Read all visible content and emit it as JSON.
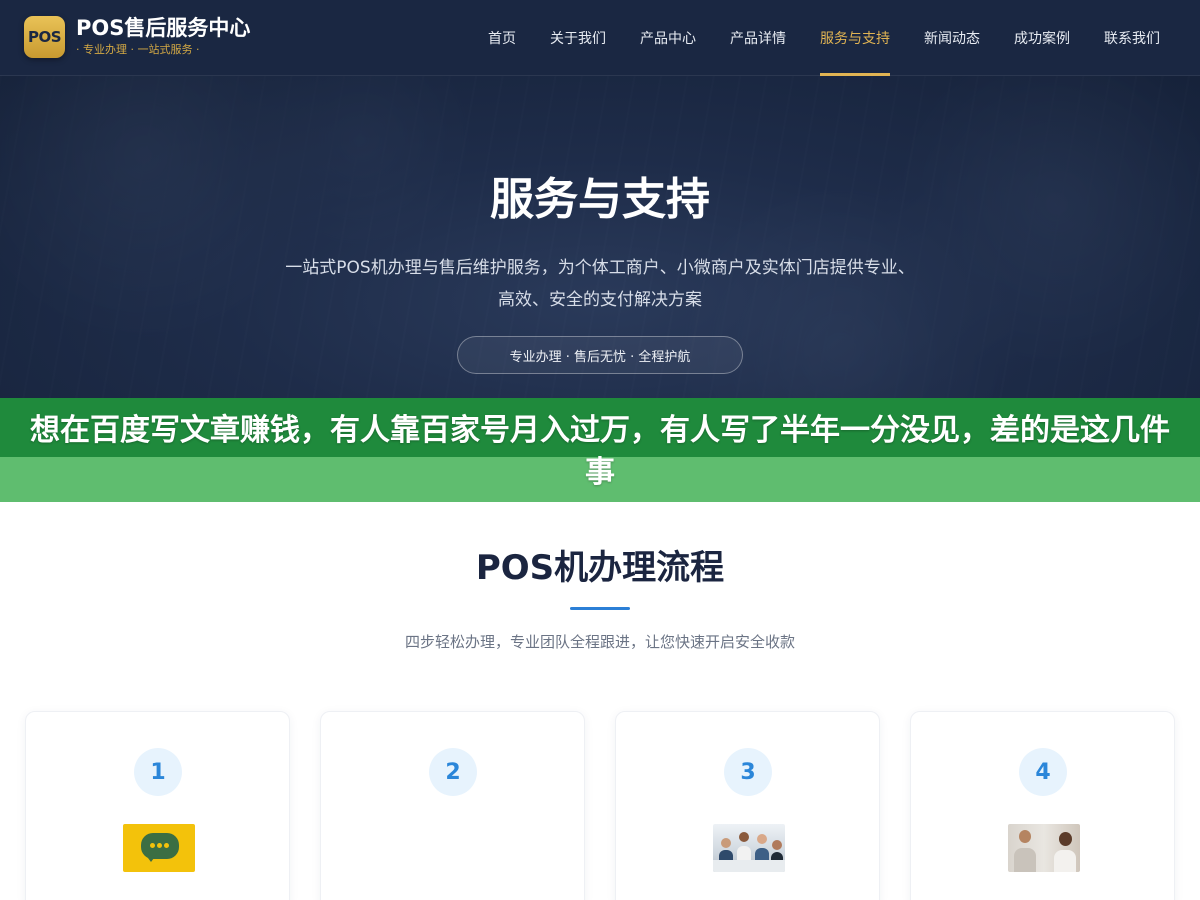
{
  "header": {
    "logo_badge": "POS",
    "logo_title": "POS售后服务中心",
    "logo_subtitle": "· 专业办理 · 一站式服务 ·",
    "nav": [
      {
        "label": "首页",
        "active": false
      },
      {
        "label": "关于我们",
        "active": false
      },
      {
        "label": "产品中心",
        "active": false
      },
      {
        "label": "产品详情",
        "active": false
      },
      {
        "label": "服务与支持",
        "active": true
      },
      {
        "label": "新闻动态",
        "active": false
      },
      {
        "label": "成功案例",
        "active": false
      },
      {
        "label": "联系我们",
        "active": false
      }
    ],
    "active_color": "#e1b453"
  },
  "hero": {
    "title": "服务与支持",
    "description": "一站式POS机办理与售后维护服务，为个体工商户、小微商户及实体门店提供专业、高效、安全的支付解决方案",
    "pill": "专业办理 · 售后无忧 · 全程护航"
  },
  "banner": {
    "text": "想在百度写文章赚钱，有人靠百家号月入过万，有人写了半年一分没见，差的是这几件事",
    "colors": {
      "top": "#1f8a3c",
      "bottom": "#5fbd6f"
    }
  },
  "process": {
    "title": "POS机办理流程",
    "description": "四步轻松办理，专业团队全程跟进，让您快速开启安全收款",
    "steps": [
      {
        "number": "1",
        "image": "chat-bubble-image"
      },
      {
        "number": "2",
        "image": ""
      },
      {
        "number": "3",
        "image": "office-team-image"
      },
      {
        "number": "4",
        "image": "meeting-image"
      }
    ]
  }
}
